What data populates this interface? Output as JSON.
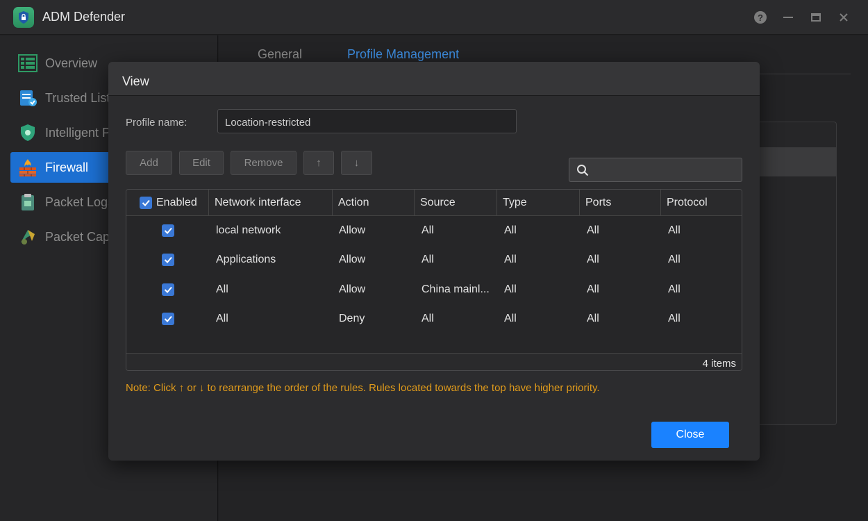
{
  "app": {
    "title": "ADM Defender"
  },
  "sidebar": {
    "items": [
      {
        "label": "Overview"
      },
      {
        "label": "Trusted List"
      },
      {
        "label": "Intelligent P"
      },
      {
        "label": "Firewall"
      },
      {
        "label": "Packet Logs"
      },
      {
        "label": "Packet Capt"
      }
    ]
  },
  "tabs": [
    {
      "label": "General"
    },
    {
      "label": "Profile Management"
    }
  ],
  "modal": {
    "title": "View",
    "profile_label": "Profile name:",
    "profile_value": "Location-restricted",
    "toolbar": {
      "add": "Add",
      "edit": "Edit",
      "remove": "Remove",
      "up": "↑",
      "down": "↓"
    },
    "search": {
      "placeholder": ""
    },
    "table": {
      "headers": [
        "Enabled",
        "Network interface",
        "Action",
        "Source",
        "Type",
        "Ports",
        "Protocol"
      ],
      "rows": [
        {
          "enabled": true,
          "interface": "local network",
          "action": "Allow",
          "source": "All",
          "type": "All",
          "ports": "All",
          "protocol": "All"
        },
        {
          "enabled": true,
          "interface": "Applications",
          "action": "Allow",
          "source": "All",
          "type": "All",
          "ports": "All",
          "protocol": "All"
        },
        {
          "enabled": true,
          "interface": "All",
          "action": "Allow",
          "source": "China mainl...",
          "type": "All",
          "ports": "All",
          "protocol": "All"
        },
        {
          "enabled": true,
          "interface": "All",
          "action": "Deny",
          "source": "All",
          "type": "All",
          "ports": "All",
          "protocol": "All"
        }
      ],
      "count": "4 items"
    },
    "note": "Note: Click ↑ or ↓ to rearrange the order of the rules. Rules located towards the top have higher priority.",
    "close_label": "Close"
  },
  "colors": {
    "accent": "#1a82ff",
    "active_nav": "#1c6fd1",
    "note": "#e09b1b",
    "tab_active": "#3d8de0"
  },
  "icons": {
    "window": [
      "help-icon",
      "minimize-icon",
      "maximize-icon",
      "close-icon"
    ],
    "sidebar": [
      "overview-icon",
      "trusted-list-icon",
      "shield-icon",
      "firewall-icon",
      "packet-logs-icon",
      "packet-capture-icon"
    ]
  }
}
